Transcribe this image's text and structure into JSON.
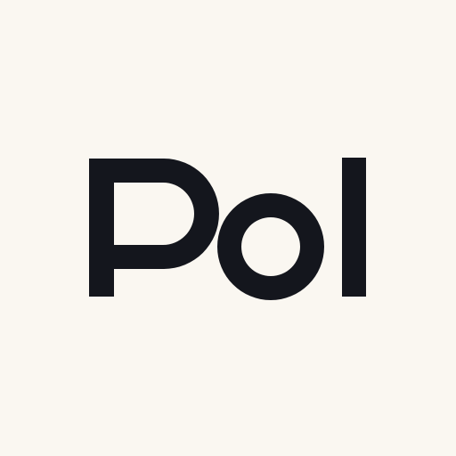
{
  "logo": {
    "text": "Pol",
    "color": "#14161d",
    "background": "#faf7f1"
  }
}
